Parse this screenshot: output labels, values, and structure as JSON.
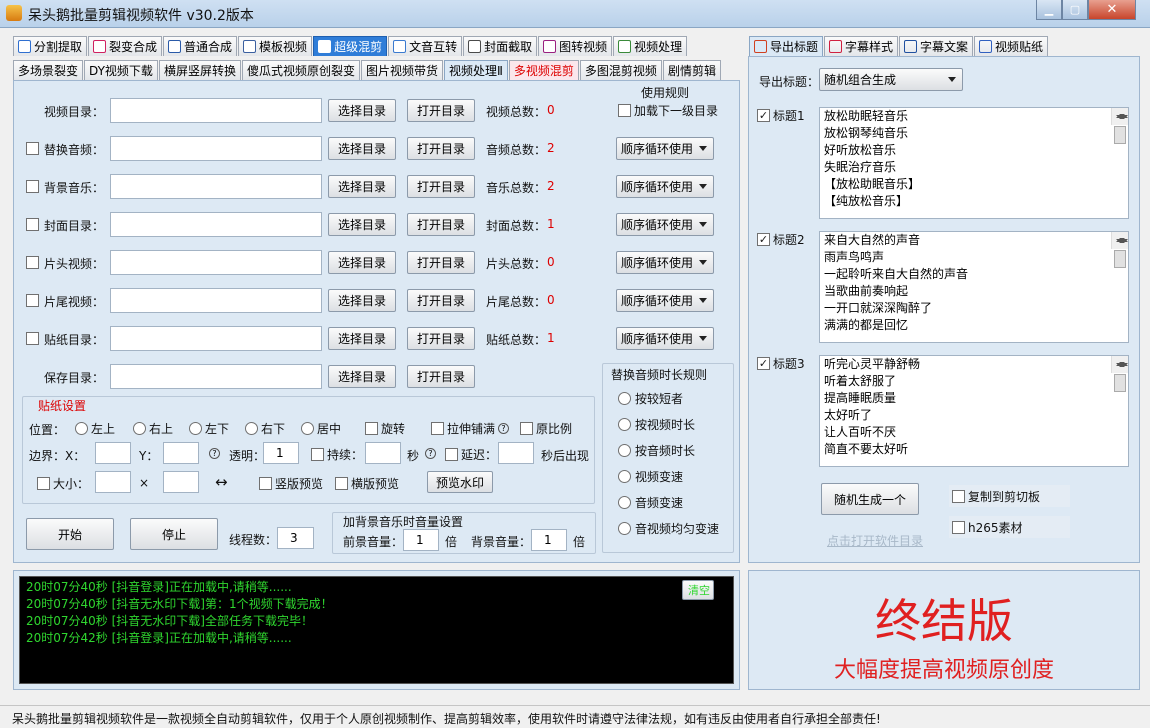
{
  "window": {
    "title": "呆头鹅批量剪辑视频软件    v30.2版本"
  },
  "tabs_row1": [
    {
      "label": "分割提取",
      "color": "#2f6fd0"
    },
    {
      "label": "裂变合成",
      "color": "#d02060"
    },
    {
      "label": "普通合成",
      "color": "#2a5aa8"
    },
    {
      "label": "模板视频",
      "color": "#3a5fa0"
    },
    {
      "label": "超级混剪",
      "color": "#ffffff"
    },
    {
      "label": "文音互转",
      "color": "#3a7ad0"
    },
    {
      "label": "封面截取",
      "color": "#4a4a4a"
    },
    {
      "label": "图转视频",
      "color": "#9a2080"
    },
    {
      "label": "视频处理",
      "color": "#3a8a3a"
    }
  ],
  "tabs_row2": [
    {
      "label": "多场景裂变"
    },
    {
      "label": "DY视频下载"
    },
    {
      "label": "横屏竖屏转换"
    },
    {
      "label": "傻瓜式视频原创裂变"
    },
    {
      "label": "图片视频带货"
    },
    {
      "label": "视频处理Ⅱ"
    },
    {
      "label": "多视频混剪"
    },
    {
      "label": "多图混剪视频"
    },
    {
      "label": "剧情剪辑"
    }
  ],
  "main": {
    "use_rule_header": "使用规则",
    "load_sub_label": "加载下一级目录",
    "rows": [
      {
        "label": "视频目录：",
        "select": "选择目录",
        "open": "打开目录",
        "count_label": "视频总数：",
        "count": "0"
      },
      {
        "label": "替换音频：",
        "select": "选择目录",
        "open": "打开目录",
        "count_label": "音频总数：",
        "count": "2",
        "rule": "顺序循环使用"
      },
      {
        "label": "背景音乐：",
        "select": "选择目录",
        "open": "打开目录",
        "count_label": "音乐总数：",
        "count": "2",
        "rule": "顺序循环使用"
      },
      {
        "label": "封面目录：",
        "select": "选择目录",
        "open": "打开目录",
        "count_label": "封面总数：",
        "count": "1",
        "rule": "顺序循环使用"
      },
      {
        "label": "片头视频：",
        "select": "选择目录",
        "open": "打开目录",
        "count_label": "片头总数：",
        "count": "0",
        "rule": "顺序循环使用"
      },
      {
        "label": "片尾视频：",
        "select": "选择目录",
        "open": "打开目录",
        "count_label": "片尾总数：",
        "count": "0",
        "rule": "顺序循环使用"
      },
      {
        "label": "贴纸目录：",
        "select": "选择目录",
        "open": "打开目录",
        "count_label": "贴纸总数：",
        "count": "1",
        "rule": "顺序循环使用"
      },
      {
        "label": "保存目录：",
        "select": "选择目录",
        "open": "打开目录"
      }
    ],
    "audio_rule": {
      "title": "替换音频时长规则",
      "options": [
        "按较短者",
        "按视频时长",
        "按音频时长",
        "视频变速",
        "音频变速",
        "音视频均匀变速"
      ]
    },
    "sticker": {
      "title": "贴纸设置",
      "position_label": "位置：",
      "positions": [
        "左上",
        "右上",
        "左下",
        "右下",
        "居中"
      ],
      "rotate": "旋转",
      "stretch": "拉伸铺满",
      "ratio": "原比例",
      "border_label": "边界：X：",
      "y_label": "Y：",
      "opacity_label": "透明：",
      "opacity_value": "1",
      "duration_label": "持续：",
      "sec": "秒",
      "delay_label": "延迟：",
      "after": "秒后出现",
      "size_label": "大小：",
      "x_sep": "×",
      "swap": "↔",
      "vert_preview": "竖版预览",
      "horiz_preview": "横版预览",
      "preview_btn": "预览水印"
    },
    "start": "开始",
    "stop": "停止",
    "threads_label": "线程数：",
    "threads": "3",
    "volume": {
      "title": "加背景音乐时音量设置",
      "fg_label": "前景音量：",
      "fg": "1",
      "bg_label": "背景音量：",
      "bg": "1",
      "unit": "倍"
    }
  },
  "log": {
    "clear": "清空",
    "lines": [
      "20时07分40秒 [抖音登录]正在加载中,请稍等......",
      "20时07分40秒 [抖音无水印下载]第：1个视频下载完成！",
      "20时07分40秒 [抖音无水印下载]全部任务下载完毕！",
      "20时07分42秒 [抖音登录]正在加载中,请稍等......"
    ]
  },
  "right_tabs": [
    {
      "label": "导出标题",
      "color": "#d04020"
    },
    {
      "label": "字幕样式",
      "color": "#d02040"
    },
    {
      "label": "字幕文案",
      "color": "#2050a0"
    },
    {
      "label": "视频贴纸",
      "color": "#3060c0"
    }
  ],
  "export": {
    "label": "导出标题：",
    "mode": "随机组合生成",
    "titles": [
      {
        "label": "标题1",
        "items": [
          "放松助眠轻音乐",
          "放松钢琴纯音乐",
          "好听放松音乐",
          "失眠治疗音乐",
          "【放松助眠音乐】",
          "【纯放松音乐】"
        ]
      },
      {
        "label": "标题2",
        "items": [
          "来自大自然的声音",
          "雨声鸟鸣声",
          "一起聆听来自大自然的声音",
          "当歌曲前奏响起",
          "一开口就深深陶醉了",
          "满满的都是回忆"
        ]
      },
      {
        "label": "标题3",
        "items": [
          "听完心灵平静舒畅",
          "听着太舒服了",
          "提高睡眠质量",
          "太好听了",
          "让人百听不厌",
          "简直不要太好听"
        ]
      }
    ],
    "random_btn": "随机生成一个",
    "copy_clip": "复制到剪切板",
    "h265": "h265素材",
    "open_dir_link": "点击打开软件目录"
  },
  "promo": {
    "big": "终结版",
    "sub": "大幅度提高视频原创度",
    "color": "#e02020"
  },
  "status": "呆头鹅批量剪辑视频软件是一款视频全自动剪辑软件，仅用于个人原创视频制作、提高剪辑效率，使用软件时请遵守法律法规，如有违反由使用者自行承担全部责任!"
}
